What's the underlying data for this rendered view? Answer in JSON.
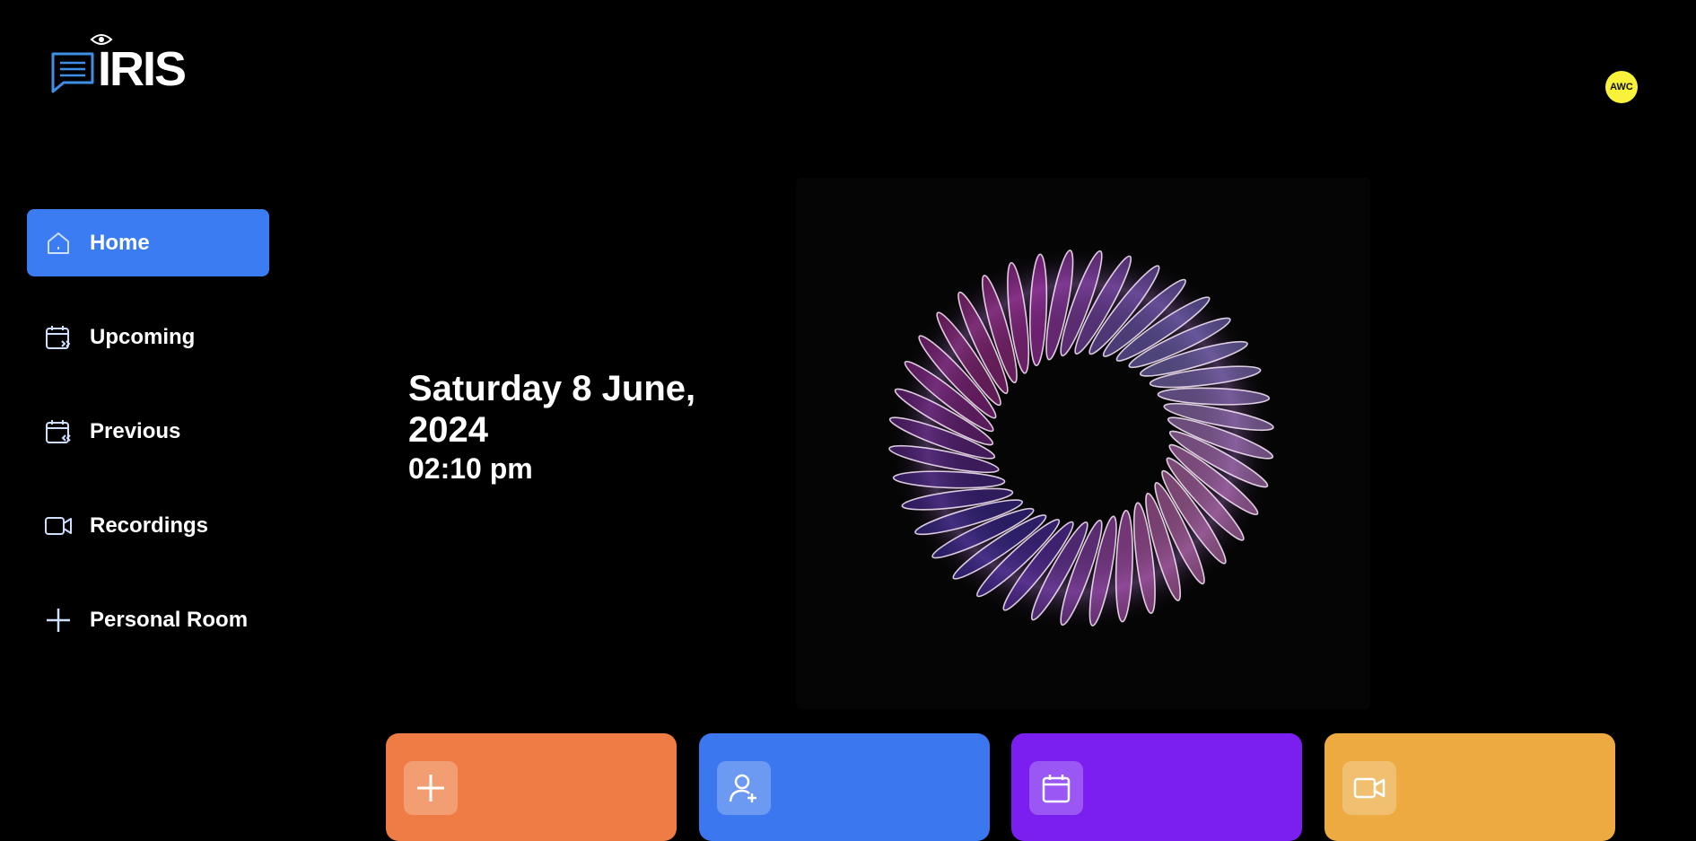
{
  "app": {
    "name": "IRIS"
  },
  "user": {
    "initials": "AWC"
  },
  "nav": {
    "items": [
      {
        "label": "Home",
        "icon": "home-icon",
        "active": true
      },
      {
        "label": "Upcoming",
        "icon": "calendar-forward-icon",
        "active": false
      },
      {
        "label": "Previous",
        "icon": "calendar-back-icon",
        "active": false
      },
      {
        "label": "Recordings",
        "icon": "video-icon",
        "active": false
      },
      {
        "label": "Personal Room",
        "icon": "plus-icon",
        "active": false
      }
    ]
  },
  "main": {
    "date": "Saturday 8 June, 2024",
    "time": "02:10 pm"
  },
  "cards": [
    {
      "icon": "plus-icon",
      "color": "#ef7c44"
    },
    {
      "icon": "user-add-icon",
      "color": "#3b78ef"
    },
    {
      "icon": "calendar-icon",
      "color": "#7a1ff0"
    },
    {
      "icon": "video-icon",
      "color": "#edaa40"
    }
  ],
  "colors": {
    "accent": "#3b7cf3",
    "avatar": "#f8f33a",
    "background": "#000000"
  }
}
